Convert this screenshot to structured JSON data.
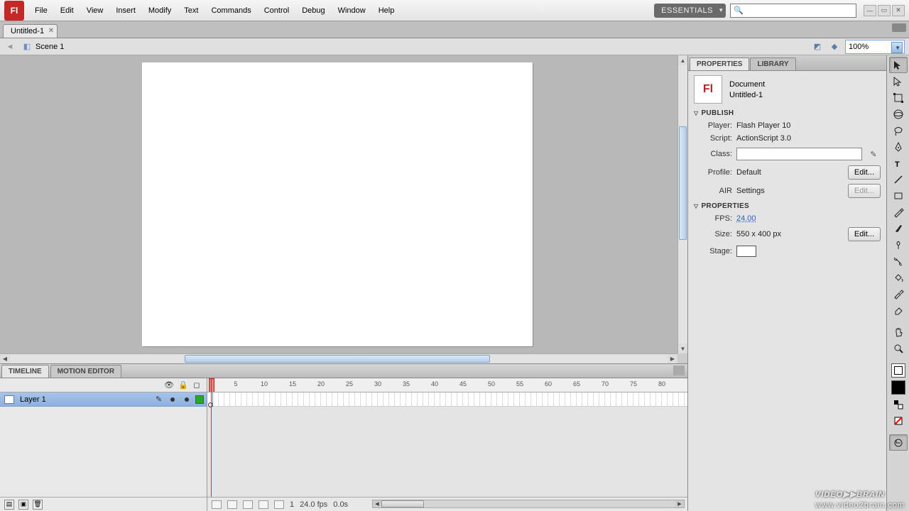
{
  "menubar": {
    "items": [
      "File",
      "Edit",
      "View",
      "Insert",
      "Modify",
      "Text",
      "Commands",
      "Control",
      "Debug",
      "Window",
      "Help"
    ]
  },
  "workspace": "ESSENTIALS",
  "doc_tab": {
    "title": "Untitled-1"
  },
  "edit_bar": {
    "scene": "Scene 1",
    "zoom": "100%"
  },
  "panels": {
    "properties_tab": "PROPERTIES",
    "library_tab": "LIBRARY",
    "doc_type": "Document",
    "doc_name": "Untitled-1",
    "sections": {
      "publish": {
        "title": "PUBLISH",
        "player_lbl": "Player:",
        "player_val": "Flash Player 10",
        "script_lbl": "Script:",
        "script_val": "ActionScript 3.0",
        "class_lbl": "Class:",
        "profile_lbl": "Profile:",
        "profile_val": "Default",
        "air_lbl": "AIR",
        "air_val": "Settings",
        "edit_label": "Edit..."
      },
      "properties": {
        "title": "PROPERTIES",
        "fps_lbl": "FPS:",
        "fps_val": "24.00",
        "size_lbl": "Size:",
        "size_val": "550 x 400 px",
        "stage_lbl": "Stage:",
        "edit_label": "Edit..."
      }
    }
  },
  "timeline": {
    "tab_timeline": "TIMELINE",
    "tab_motion": "MOTION EDITOR",
    "layer_name": "Layer 1",
    "ruler_ticks": [
      5,
      10,
      15,
      20,
      25,
      30,
      35,
      40,
      45,
      50,
      55,
      60,
      65,
      70,
      75,
      80
    ],
    "status": {
      "frame": "1",
      "fps": "24.0 fps",
      "time": "0.0s"
    }
  },
  "watermark": {
    "brand": "VIDEO▶▶BRAIN",
    "url": "www.video2brain.com"
  }
}
